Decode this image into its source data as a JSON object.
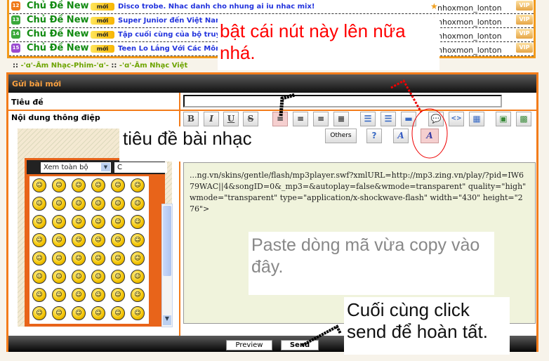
{
  "topics": [
    {
      "num": "12",
      "num_color": "#f07a1a",
      "label": "Chủ Đề New",
      "badge": "mới",
      "title": "Disco trobe. Nhac danh cho nhung ai iu nhac mix!",
      "user": "nhoxmon_lonton",
      "vip": "VIP"
    },
    {
      "num": "13",
      "num_color": "#3aa83a",
      "label": "Chủ Đề New",
      "badge": "mới",
      "title": "Super Junior đến Việt Nam",
      "user": "nhoxmon_lonton",
      "vip": "VIP"
    },
    {
      "num": "14",
      "num_color": "#3aa83a",
      "label": "Chủ Đề New",
      "badge": "mới",
      "title": "Tập cuối cùng của bộ truyệ",
      "user": "nhoxmon_lonton",
      "vip": "VIP"
    },
    {
      "num": "15",
      "num_color": "#9a4ad0",
      "label": "Chủ Đề New",
      "badge": "mới",
      "title": "Teen Lo Lắng Với Các Môn",
      "user": "nhoxmon_lonton",
      "vip": "VIP"
    }
  ],
  "breadcrumb": {
    "sep": "::",
    "items": [
      "-'ɑ'-Âm Nhạc-Phim-'ɑ'-",
      "-'ɑ'-Âm Nhạc Việt"
    ]
  },
  "form": {
    "header": "Gửi bài mới",
    "title_label": "Tiêu đề",
    "title_value": "",
    "message_label": "Nội dung thông điệp",
    "toolbar": {
      "bold": "B",
      "italic": "I",
      "underline": "U",
      "strike": "S",
      "others": "Others"
    },
    "editor_text": "...ng.vn/skins/gentle/flash/mp3player.swf?xmlURL=http://mp3.zing.vn/play/?pid=IW679WAC||4&songID=0&_mp3=&autoplay=false&wmode=transparent\" quality=\"high\" wmode=\"transparent\" type=\"application/x-shockwave-flash\" width=\"430\" height=\"276\">",
    "smiley_select": "Xem toàn bộ",
    "smiley_select2": "C",
    "preview": "Preview",
    "send": "Send"
  },
  "annotations": {
    "toggle_button": "bật cái nút này lên nữa nhá.",
    "song_title": "tiêu đề bài nhạc",
    "paste_here": "Paste dòng mã vừa copy vào đây.",
    "click_send": "Cuối cùng click send để hoàn tất."
  },
  "colors": {
    "accent": "#f37c1a",
    "green": "#118a11",
    "link": "#2233dd",
    "annotation_red": "#ff0000"
  }
}
